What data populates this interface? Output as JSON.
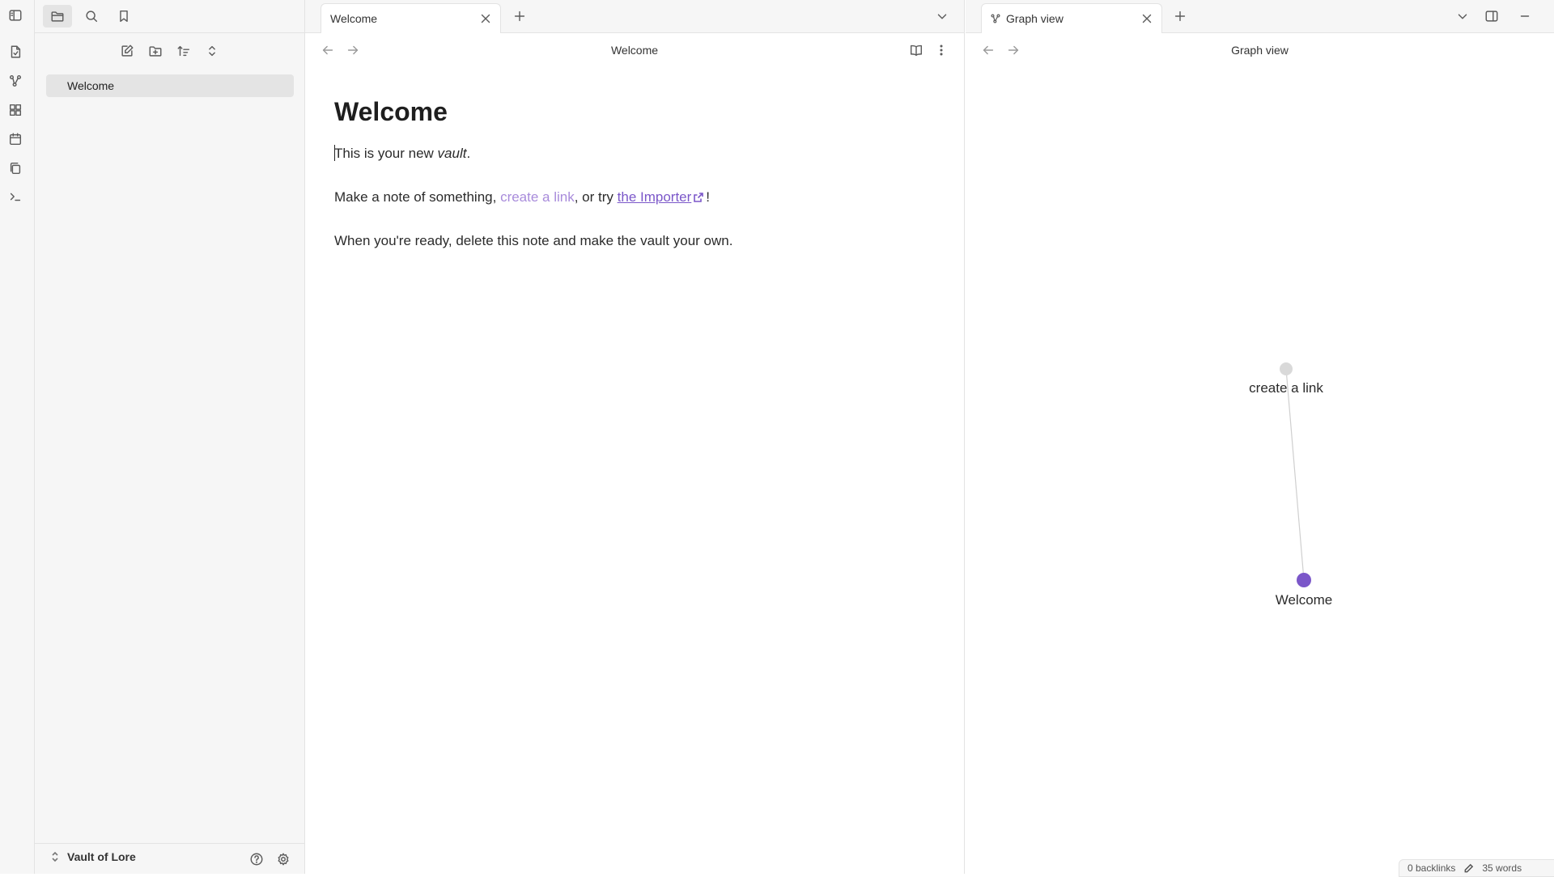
{
  "sidebar": {
    "files": [
      {
        "label": "Welcome",
        "selected": true
      }
    ],
    "vault_name": "Vault of Lore"
  },
  "left_pane": {
    "tab": {
      "label": "Welcome"
    },
    "view_title": "Welcome",
    "note": {
      "heading": "Welcome",
      "line1": {
        "before": "This is your new ",
        "emphasis": "vault",
        "after": "."
      },
      "line2": {
        "before": "Make a note of something, ",
        "link": "create a link",
        "middle": ", or try ",
        "external_link": "the Importer",
        "after": "!"
      },
      "line3": "When you're ready, delete this note and make the vault your own."
    }
  },
  "right_pane": {
    "tab": {
      "label": "Graph view"
    },
    "view_title": "Graph view",
    "graph": {
      "nodes": [
        {
          "id": "create-a-link",
          "label": "create a link",
          "resolved": false
        },
        {
          "id": "welcome",
          "label": "Welcome",
          "resolved": true,
          "active": true
        }
      ],
      "edges": [
        [
          "create-a-link",
          "welcome"
        ]
      ]
    }
  },
  "status_bar": {
    "backlinks": "0 backlinks",
    "words": "35 words"
  },
  "colors": {
    "accent": "#7b57c9",
    "unresolved_link": "#a88bdb",
    "graph_node_active": "#7b57c9",
    "graph_node_muted": "#d9d9d9"
  },
  "icons": [
    "sidebar-toggle-icon",
    "folder-icon",
    "search-icon",
    "bookmark-icon",
    "file-icon",
    "graph-icon",
    "grid-icon",
    "calendar-icon",
    "copy-icon",
    "terminal-icon",
    "new-note-icon",
    "new-folder-icon",
    "sort-icon",
    "collapse-icon",
    "help-icon",
    "settings-icon",
    "close-icon",
    "plus-icon",
    "chevron-down-icon",
    "back-arrow-icon",
    "forward-arrow-icon",
    "book-icon",
    "more-icon",
    "split-icon",
    "minimize-icon",
    "edit-icon"
  ]
}
